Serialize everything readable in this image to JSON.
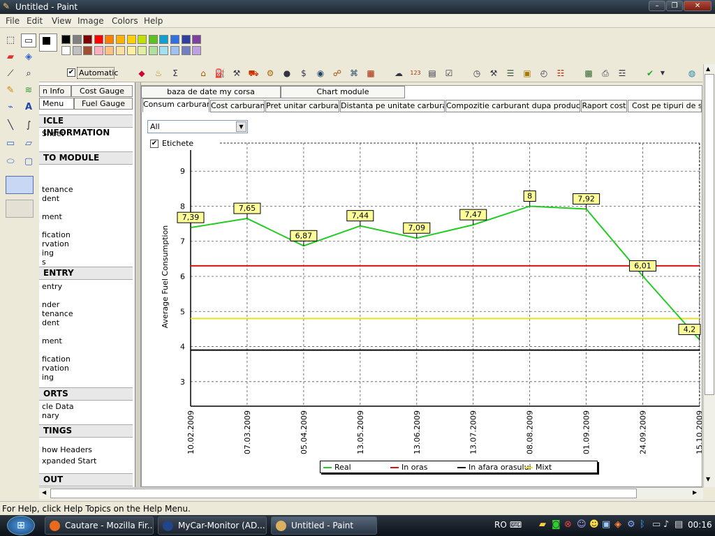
{
  "window": {
    "title": "Untitled - Paint"
  },
  "menu": [
    "File",
    "Edit",
    "View",
    "Image",
    "Colors",
    "Help"
  ],
  "palette": {
    "row1": [
      "#000000",
      "#808080",
      "#7f0000",
      "#ff0000",
      "#ff8000",
      "#ffb300",
      "#ffd000",
      "#c0e000",
      "#60c020",
      "#10a0d0",
      "#3070e0",
      "#3040a0",
      "#8040a0"
    ],
    "row2": [
      "#ffffff",
      "#c0c0c0",
      "#a05030",
      "#ffb0c0",
      "#ffc080",
      "#ffe0a0",
      "#fff0a0",
      "#e0f0a0",
      "#b0e0a0",
      "#a0e0f0",
      "#a0c0f0",
      "#7080c0",
      "#c0a0e0"
    ]
  },
  "app_toolbar": {
    "automatic_label": "Automatic",
    "automatic_checked": "✔"
  },
  "left_panel": {
    "tabs": [
      "n Info",
      "Cost Gauge",
      "Menu",
      "Fuel Gauge"
    ],
    "headers": [
      "ICLE INFORMATION",
      "TO MODULE",
      "ENTRY",
      "ORTS",
      "TINGS",
      "OUT"
    ],
    "items_a": [
      "Sheet"
    ],
    "items_b": [
      "tenance",
      "dent",
      "ment",
      "fication",
      "rvation",
      "ing",
      "s"
    ],
    "items_c": [
      "entry",
      "nder",
      "tenance",
      "dent",
      "ment",
      "fication",
      "rvation",
      "ing"
    ],
    "items_d": [
      "cle Data",
      "nary"
    ],
    "items_e": [
      "how Headers",
      "xpanded Start"
    ]
  },
  "top_tabs": [
    "baza de date my corsa",
    "Chart module"
  ],
  "chart_tabs": [
    "Consum carburant",
    "Cost carburant",
    "Pret unitar carburant",
    "Distanta pe unitate carburant",
    "Compozitie carburant dupa producatori",
    "Raport cost",
    "Cost pe tipuri de ser"
  ],
  "filter": {
    "selected": "All",
    "etichete_label": "Etichete",
    "etichete_checked": "✔"
  },
  "chart_data": {
    "type": "line",
    "ylabel": "Average Fuel Consumption",
    "xlabel": "",
    "ylim": [
      2.3,
      9.8
    ],
    "yticks": [
      3,
      4,
      5,
      6,
      7,
      8,
      9
    ],
    "categories": [
      "10.02.2009",
      "07.03.2009",
      "05.04.2009",
      "13.05.2009",
      "13.06.2009",
      "13.07.2009",
      "08.08.2009",
      "01.09.2009",
      "24.09.2009",
      "15.10.2009"
    ],
    "series": [
      {
        "name": "Real",
        "color": "#22cc22",
        "values": [
          7.39,
          7.65,
          6.87,
          7.44,
          7.09,
          7.47,
          8,
          7.92,
          6.01,
          4.2
        ],
        "labels": [
          "7,39",
          "7,65",
          "6,87",
          "7,44",
          "7,09",
          "7,47",
          "8",
          "7,92",
          "6,01",
          "4,2"
        ]
      },
      {
        "name": "In oras",
        "color": "#dd1111",
        "constant": 6.3
      },
      {
        "name": "In afara orasului",
        "color": "#000000",
        "constant": 3.9
      },
      {
        "name": "Mixt",
        "color": "#e8e020",
        "constant": 4.8
      }
    ],
    "grid": true,
    "legend": "bottom"
  },
  "status": {
    "text": "For Help, click Help Topics on the Help Menu."
  },
  "taskbar": {
    "tasks": [
      "Cautare - Mozilla Fir...",
      "MyCar-Monitor (AD...",
      "Untitled - Paint"
    ],
    "language": "RO",
    "clock": "00:16"
  }
}
